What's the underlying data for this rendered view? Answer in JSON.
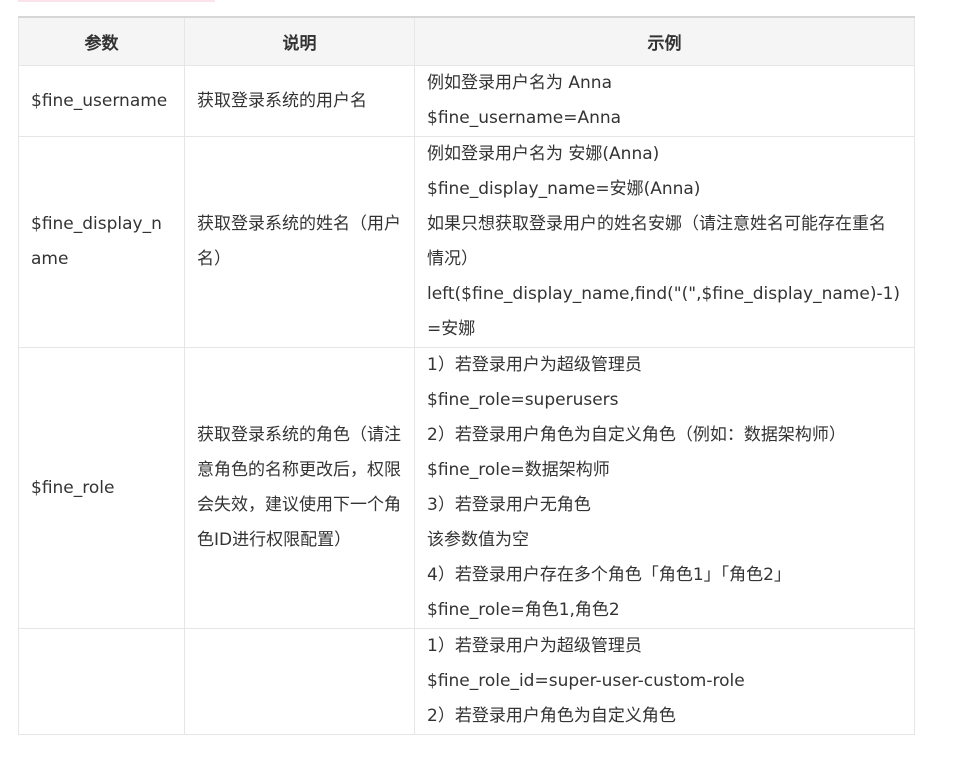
{
  "table": {
    "headers": [
      "参数",
      "说明",
      "示例"
    ],
    "rows": [
      {
        "param": "$fine_username",
        "desc": "获取登录系统的用户名",
        "examples": [
          "例如登录用户名为 Anna",
          "$fine_username=Anna"
        ]
      },
      {
        "param": "$fine_display_name",
        "desc": "获取登录系统的姓名（用户名）",
        "examples": [
          "例如登录用户名为 安娜(Anna)",
          "$fine_display_name=安娜(Anna)",
          "如果只想获取登录用户的姓名安娜（请注意姓名可能存在重名情况）",
          "left($fine_display_name,find(\"(\",$fine_display_name)-1)=安娜"
        ]
      },
      {
        "param": "$fine_role",
        "desc": "获取登录系统的角色（请注意角色的名称更改后，权限会失效，建议使用下一个角色ID进行权限配置）",
        "examples": [
          "1）若登录用户为超级管理员",
          "$fine_role=superusers",
          "2）若登录用户角色为自定义角色（例如：数据架构师）",
          "$fine_role=数据架构师",
          "3）若登录用户无角色",
          "该参数值为空",
          "4）若登录用户存在多个角色「角色1」「角色2」",
          "$fine_role=角色1,角色2"
        ]
      },
      {
        "param": "",
        "desc": "",
        "examples": [
          "1）若登录用户为超级管理员",
          "$fine_role_id=super-user-custom-role",
          "2）若登录用户角色为自定义角色"
        ]
      }
    ]
  }
}
